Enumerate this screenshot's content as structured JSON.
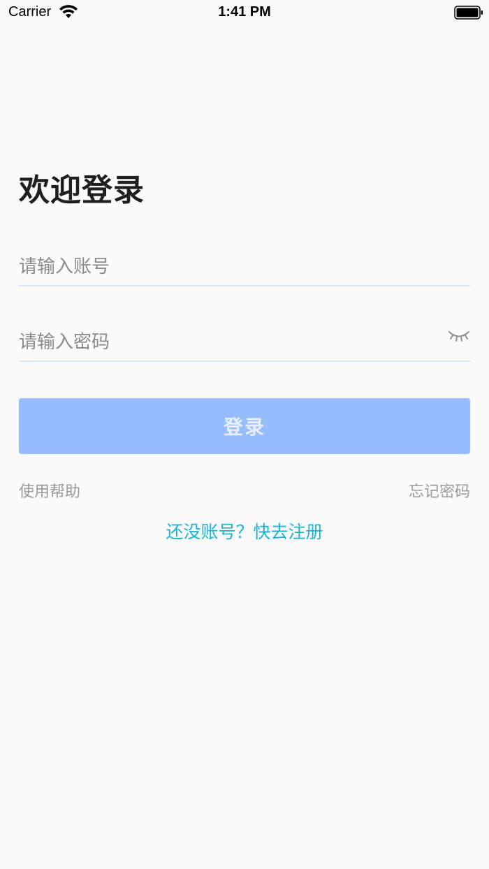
{
  "status_bar": {
    "carrier": "Carrier",
    "time": "1:41 PM"
  },
  "login": {
    "title": "欢迎登录",
    "account_placeholder": "请输入账号",
    "password_placeholder": "请输入密码",
    "submit_label": "登录",
    "help_label": "使用帮助",
    "forgot_label": "忘记密码",
    "register_label": "还没账号？快去注册"
  },
  "icons": {
    "wifi": "wifi-icon",
    "battery": "battery-icon",
    "password_toggle": "eye-closed-icon"
  },
  "colors": {
    "background": "#fafafa",
    "button": "#97bcfb",
    "link_accent": "#1ab5d2",
    "input_underline": "#dbe6f5",
    "secondary_text": "#999999"
  }
}
